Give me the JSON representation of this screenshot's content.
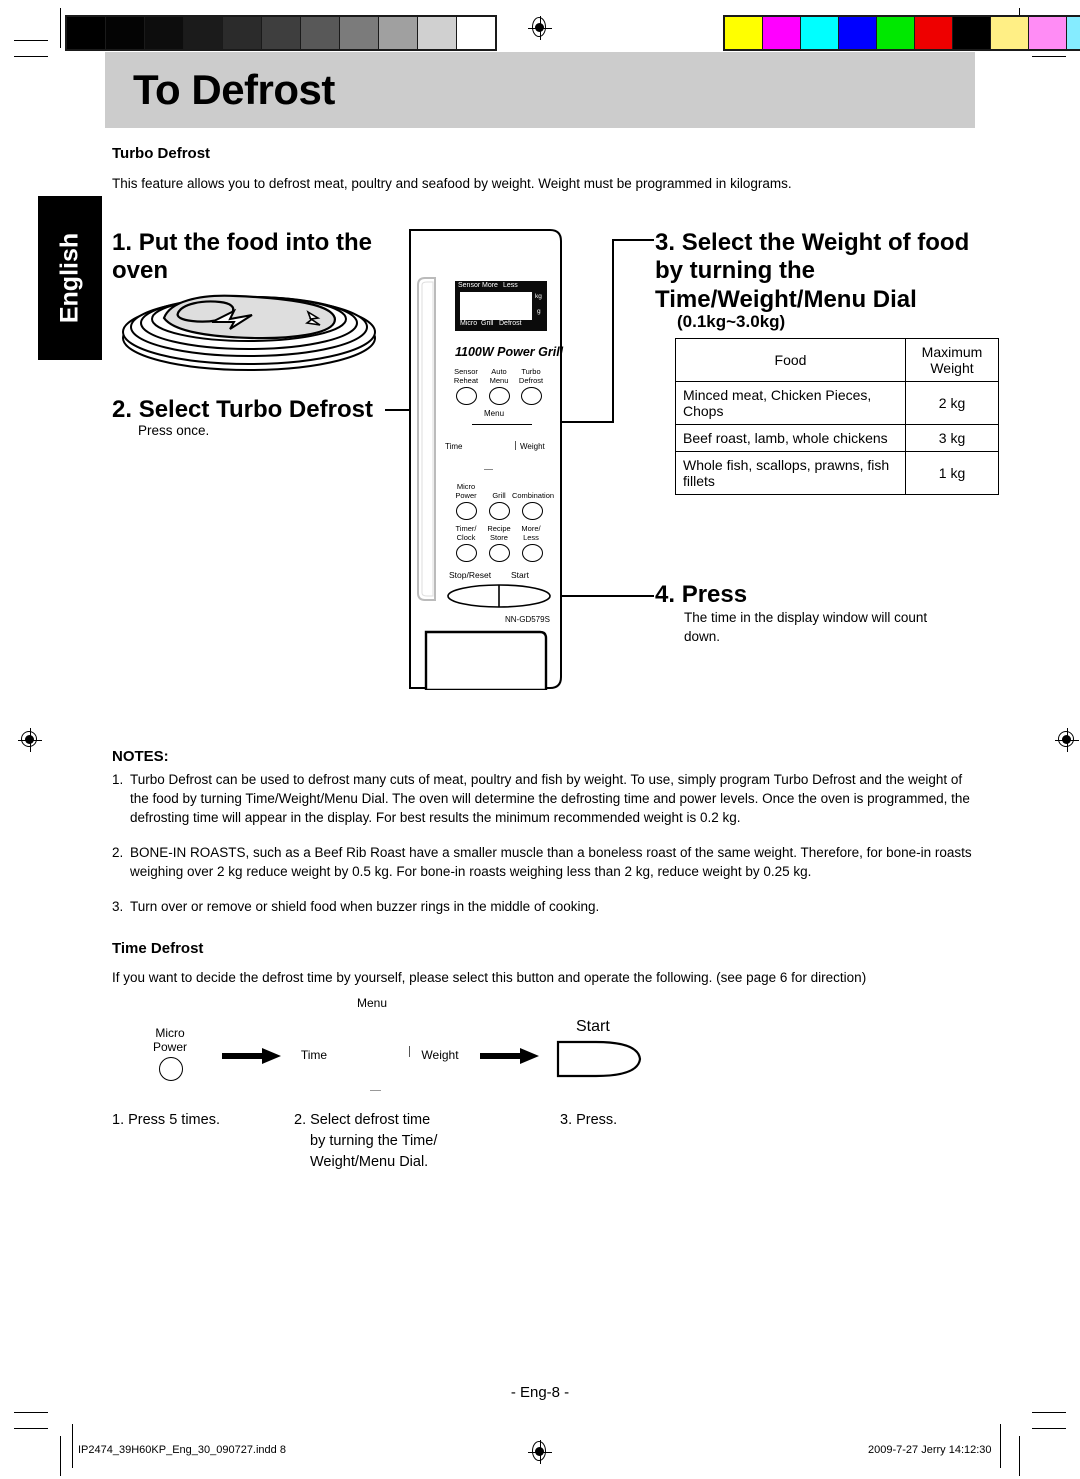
{
  "page": {
    "title": "To Defrost",
    "language_tab": "English",
    "page_number": "- Eng-8 -"
  },
  "turbo": {
    "heading": "Turbo Defrost",
    "intro": "This feature allows you to defrost meat, poultry and seafood by weight. Weight must be programmed in kilograms.",
    "steps": [
      {
        "num": "1.",
        "title": "Put the food into the oven",
        "sub": ""
      },
      {
        "num": "2.",
        "title": "Select Turbo Defrost",
        "sub": "Press once."
      },
      {
        "num": "3.",
        "title": "Select the Weight of food by turning the Time/Weight/Menu Dial",
        "range": "(0.1kg~3.0kg)"
      },
      {
        "num": "4.",
        "title": "Press",
        "sub": "The time in the display window will count down."
      }
    ]
  },
  "weight_table": {
    "headers": [
      "Food",
      "Maximum Weight"
    ],
    "header_food": "Food",
    "header_max_line1": "Maximum",
    "header_max_line2": "Weight",
    "rows": [
      {
        "food": "Minced meat, Chicken Pieces, Chops",
        "max": "2 kg"
      },
      {
        "food": "Beef roast, lamb, whole chickens",
        "max": "3 kg"
      },
      {
        "food": "Whole fish, scallops, prawns, fish fillets",
        "max": "1 kg"
      }
    ]
  },
  "notes": {
    "title": "NOTES:",
    "items": [
      {
        "num": "1.",
        "text": "Turbo Defrost can be used to defrost many cuts of meat, poultry and fish by weight. To use, simply program Turbo Defrost and the weight of the food by turning Time/Weight/Menu Dial. The oven will determine the defrosting time and power levels. Once the oven is programmed, the defrosting time will appear in the display. For best results the minimum recommended weight is 0.2 kg."
      },
      {
        "num": "2.",
        "text": "BONE-IN ROASTS, such as a Beef Rib Roast have a smaller muscle than a boneless roast of the same weight. Therefore, for bone-in roasts weighing over 2 kg reduce weight by 0.5 kg. For bone-in roasts weighing less than 2 kg, reduce weight by 0.25 kg."
      },
      {
        "num": "3.",
        "text": "Turn over or remove or shield food when buzzer rings in the middle of cooking."
      }
    ]
  },
  "time_defrost": {
    "heading": "Time Defrost",
    "intro": "If you want to decide the defrost time by yourself, please select this button and operate the following. (see page 6 for direction)",
    "menu_label": "Menu",
    "micro_power_line1": "Micro",
    "micro_power_line2": "Power",
    "time_label": "Time",
    "weight_label": "Weight",
    "start_label": "Start",
    "steps": [
      "1. Press 5 times.",
      "2. Select defrost time by turning the Time/ Weight/Menu Dial.",
      "3. Press."
    ],
    "step1": "1. Press 5 times.",
    "step2_l1": "2. Select defrost time",
    "step2_l2": "by turning the Time/",
    "step2_l3": "Weight/Menu Dial.",
    "step3": "3. Press."
  },
  "control_panel": {
    "display": {
      "top_indicators": [
        "Sensor",
        "More",
        "Less"
      ],
      "bottom_indicators": [
        "Micro",
        "Grill",
        "Defrost"
      ],
      "unit_kg": "kg",
      "unit_g": "g"
    },
    "model_name": "1100W Power Grill",
    "model_number": "NN-GD579S",
    "menu_label": "Menu",
    "dial_time_label": "Time",
    "dial_weight_label": "Weight",
    "buttons_row1": [
      {
        "l1": "Sensor",
        "l2": "Reheat"
      },
      {
        "l1": "Auto",
        "l2": "Menu"
      },
      {
        "l1": "Turbo",
        "l2": "Defrost"
      }
    ],
    "buttons_row2": [
      {
        "l1": "Micro",
        "l2": "Power"
      },
      {
        "l1": "Grill",
        "l2": ""
      },
      {
        "l1": "Combination",
        "l2": ""
      }
    ],
    "buttons_row3": [
      {
        "l1": "Timer/",
        "l2": "Clock"
      },
      {
        "l1": "Recipe",
        "l2": "Store"
      },
      {
        "l1": "More/",
        "l2": "Less"
      }
    ],
    "stop_label": "Stop/Reset",
    "start_label": "Start"
  },
  "footer": {
    "left": "IP2474_39H60KP_Eng_30_090727.indd   8",
    "right": "2009-7-27   Jerry 14:12:30"
  },
  "calibration": {
    "gray_swatches": [
      "#000000",
      "#040404",
      "#0d0d0d",
      "#1b1b1b",
      "#2b2b2b",
      "#3e3e3e",
      "#585858",
      "#7b7b7b",
      "#a0a0a0",
      "#d0d0d0",
      "#ffffff"
    ],
    "color_swatches": [
      "#ffff00",
      "#ff00ff",
      "#00ffff",
      "#0000ff",
      "#00e800",
      "#ee0000",
      "#000000",
      "#ffef85",
      "#ff8cf5",
      "#85ecff",
      "#808080"
    ]
  }
}
